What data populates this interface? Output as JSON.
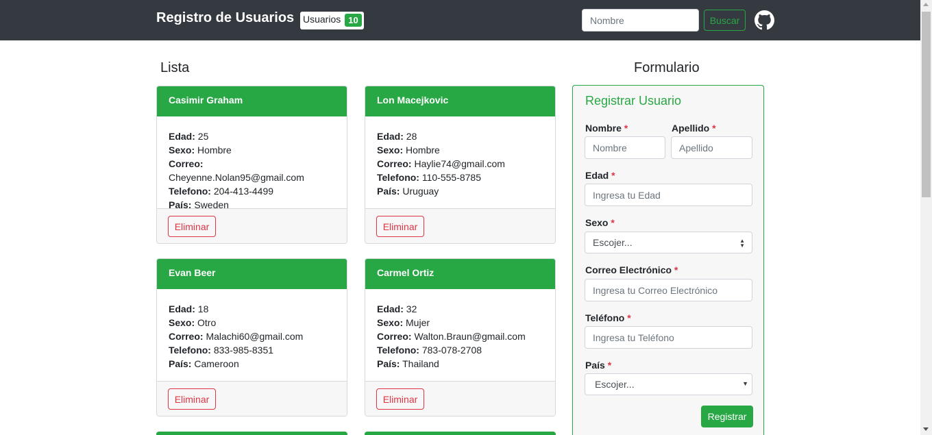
{
  "navbar": {
    "brand": "Registro de Usuarios",
    "users_label": "Usuarios",
    "users_count": "10",
    "search_placeholder": "Nombre",
    "search_button": "Buscar",
    "github_icon": "github-icon"
  },
  "list": {
    "title": "Lista",
    "labels": {
      "age": "Edad:",
      "sex": "Sexo:",
      "email": "Correo:",
      "phone": "Telefono:",
      "country": "País:"
    },
    "delete_label": "Eliminar",
    "users": [
      {
        "name": "Casimir Graham",
        "age": "25",
        "sex": "Hombre",
        "email": "Cheyenne.Nolan95@gmail.com",
        "phone": "204-413-4499",
        "country": "Sweden"
      },
      {
        "name": "Lon Macejkovic",
        "age": "28",
        "sex": "Hombre",
        "email": "Haylie74@gmail.com",
        "phone": "110-555-8785",
        "country": "Uruguay"
      },
      {
        "name": "Evan Beer",
        "age": "18",
        "sex": "Otro",
        "email": "Malachi60@gmail.com",
        "phone": "833-985-8351",
        "country": "Cameroon"
      },
      {
        "name": "Carmel Ortiz",
        "age": "32",
        "sex": "Mujer",
        "email": "Walton.Braun@gmail.com",
        "phone": "783-078-2708",
        "country": "Thailand"
      }
    ]
  },
  "form": {
    "section_title": "Formulario",
    "title": "Registrar Usuario",
    "required_mark": "*",
    "first_name": {
      "label": "Nombre",
      "placeholder": "Nombre"
    },
    "last_name": {
      "label": "Apellido",
      "placeholder": "Apellido"
    },
    "age": {
      "label": "Edad",
      "placeholder": "Ingresa tu Edad"
    },
    "sex": {
      "label": "Sexo",
      "selected": "Escojer..."
    },
    "email": {
      "label": "Correo Electrónico",
      "placeholder": "Ingresa tu Correo Electrónico"
    },
    "phone": {
      "label": "Teléfono",
      "placeholder": "Ingresa tu Teléfono"
    },
    "country": {
      "label": "País",
      "selected": "Escojer..."
    },
    "submit": "Registrar"
  },
  "colors": {
    "navbar": "#343a40",
    "success": "#28a745",
    "danger": "#dc3545"
  }
}
